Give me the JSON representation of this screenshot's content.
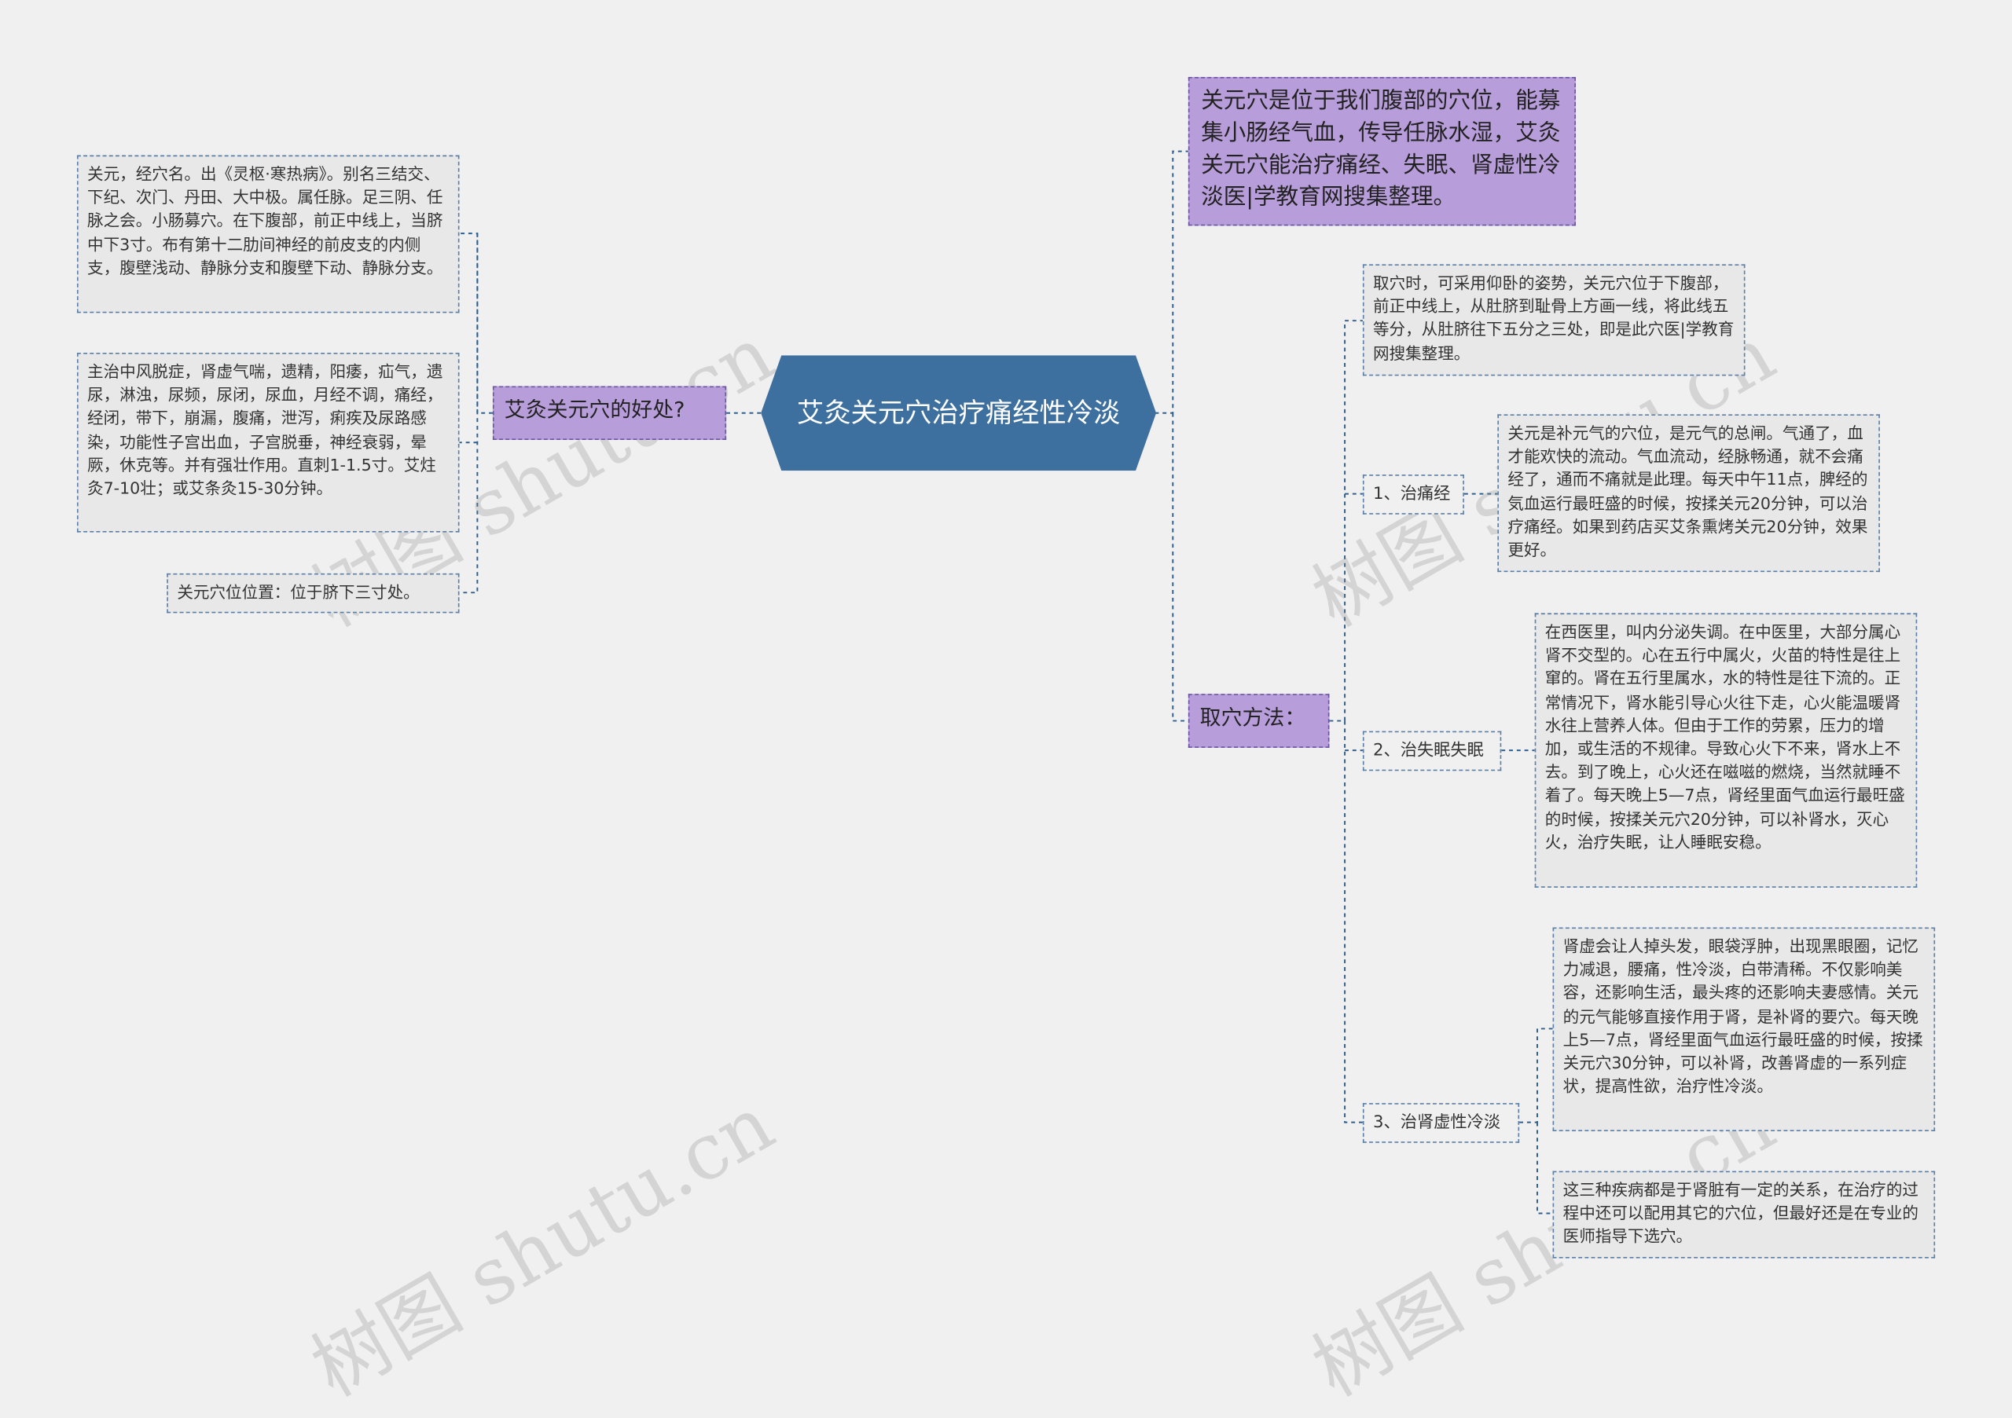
{
  "root": {
    "title": "艾灸关元穴治疗痛经性冷淡"
  },
  "left": {
    "branch_label": "艾灸关元穴的好处?",
    "notes": [
      "关元，经穴名。出《灵枢·寒热病》。别名三结交、下纪、次门、丹田、大中极。属任脉。足三阴、任脉之会。小肠募穴。在下腹部，前正中线上，当脐中下3寸。布有第十二肋间神经的前皮支的内侧支，腹壁浅动、静脉分支和腹壁下动、静脉分支。",
      "主治中风脱症，肾虚气喘，遗精，阳痿，疝气，遗尿，淋浊，尿频，尿闭，尿血，月经不调，痛经，经闭，带下，崩漏，腹痛，泄泻，痢疾及尿路感染，功能性子宫出血，子宫脱垂，神经衰弱，晕厥，休克等。并有强壮作用。直刺1-1.5寸。艾炷灸7-10壮；或艾条灸15-30分钟。",
      "关元穴位位置：位于脐下三寸处。"
    ]
  },
  "right": {
    "summary": "关元穴是位于我们腹部的穴位，能募集小肠经气血，传导任脉水湿，艾灸关元穴能治疗痛经、失眠、肾虚性冷淡医|学教育网搜集整理。",
    "method_label": "取穴方法：",
    "method_note": "取穴时，可采用仰卧的姿势，关元穴位于下腹部，前正中线上，从肚脐到耻骨上方画一线，将此线五等分，从肚脐往下五分之三处，即是此穴医|学教育网搜集整理。",
    "items": [
      {
        "label": "1、治痛经",
        "notes": [
          "关元是补元气的穴位，是元气的总闸。气通了，血才能欢快的流动。气血流动，经脉畅通，就不会痛经了，通而不痛就是此理。每天中午11点，脾经的気血运行最旺盛的时候，按揉关元20分钟，可以治疗痛经。如果到药店买艾条熏烤关元20分钟，效果更好。"
        ]
      },
      {
        "label": "2、治失眠失眠",
        "notes": [
          "在西医里，叫内分泌失调。在中医里，大部分属心肾不交型的。心在五行中属火，火苗的特性是往上窜的。肾在五行里属水，水的特性是往下流的。正常情况下，肾水能引导心火往下走，心火能温暖肾水往上营养人体。但由于工作的劳累，压力的增加，或生活的不规律。导致心火下不来，肾水上不去。到了晚上，心火还在嗞嗞的燃烧，当然就睡不着了。每天晚上5—7点，肾经里面气血运行最旺盛的时候，按揉关元穴20分钟，可以补肾水，灭心火，治疗失眠，让人睡眠安稳。"
        ]
      },
      {
        "label": "3、治肾虚性冷淡",
        "notes": [
          "肾虚会让人掉头发，眼袋浮肿，出现黑眼圈，记忆力减退，腰痛，性冷淡，白带清稀。不仅影响美容，还影响生活，最头疼的还影响夫妻感情。关元的元气能够直接作用于肾，是补肾的要穴。每天晚上5—7点，肾经里面气血运行最旺盛的时候，按揉关元穴30分钟，可以补肾，改善肾虚的一系列症状，提高性欲，治疗性冷淡。",
          "这三种疾病都是于肾脏有一定的关系，在治疗的过程中还可以配用其它的穴位，但最好还是在专业的医师指导下选穴。"
        ]
      }
    ]
  },
  "watermark": "树图 shutu.cn",
  "colors": {
    "root": "#3d6f9f",
    "purple": "#b89ddb",
    "line": "#2f5f8f",
    "background": "#f0f0f0"
  }
}
